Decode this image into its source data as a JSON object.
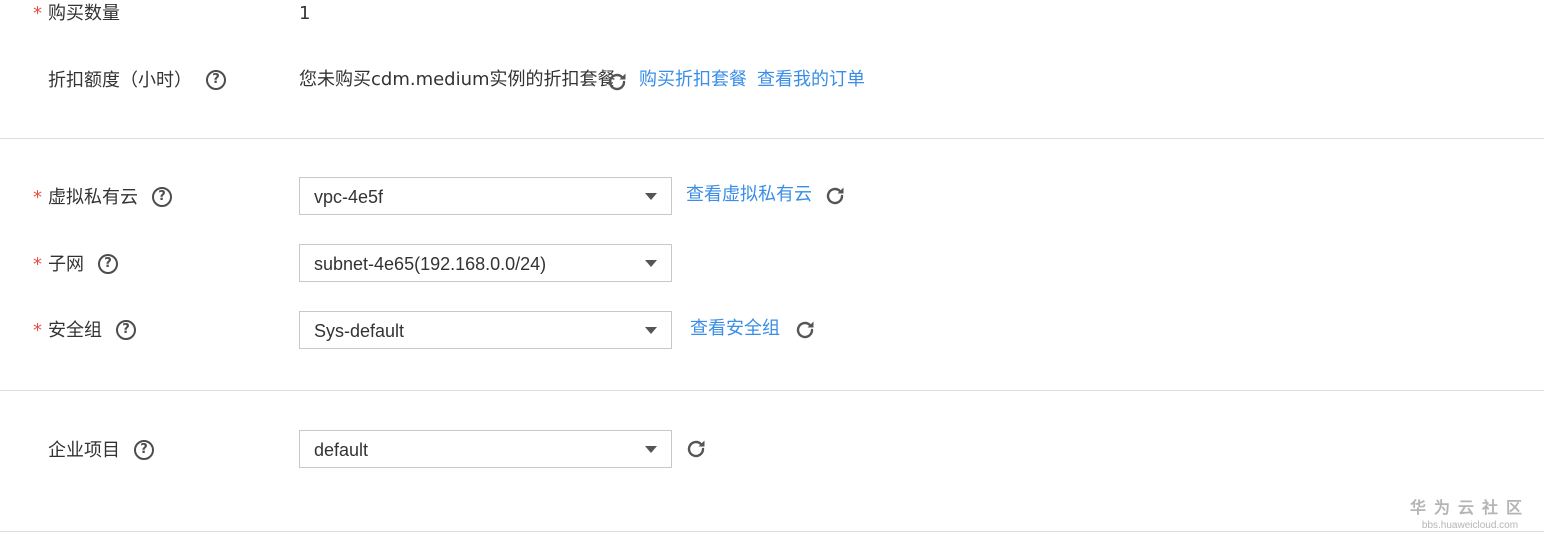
{
  "quantity": {
    "label": "购买数量",
    "value": "1"
  },
  "discount": {
    "label": "折扣额度（小时）",
    "message": "您未购买cdm.medium实例的折扣套餐",
    "buy_link": "购买折扣套餐",
    "orders_link": "查看我的订单"
  },
  "vpc": {
    "label": "虚拟私有云",
    "value": "vpc-4e5f",
    "link": "查看虚拟私有云"
  },
  "subnet": {
    "label": "子网",
    "value": "subnet-4e65(192.168.0.0/24)"
  },
  "security_group": {
    "label": "安全组",
    "value": "Sys-default",
    "link": "查看安全组"
  },
  "enterprise_project": {
    "label": "企业项目",
    "value": "default"
  },
  "required_mark": "*",
  "help_mark": "?",
  "watermark": {
    "title": "华为云社区",
    "url": "bbs.huaweicloud.com"
  },
  "colors": {
    "link": "#3a8ee6",
    "required": "#e84e40",
    "divider": "#dedede"
  }
}
